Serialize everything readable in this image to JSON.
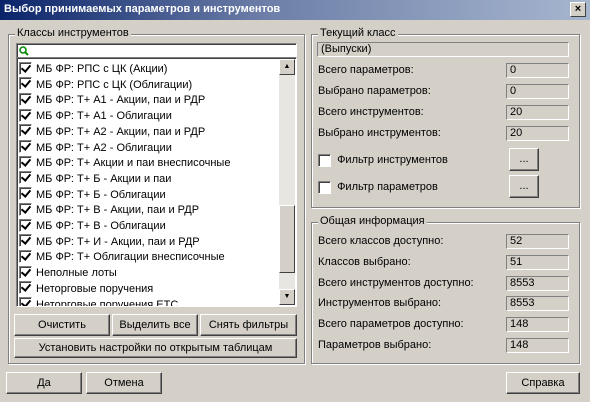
{
  "window": {
    "title": "Выбор принимаемых параметров и инструментов",
    "close_glyph": "×"
  },
  "instruments_group": {
    "legend": "Классы инструментов",
    "filter_icon": "search-icon",
    "items": [
      {
        "label": "МБ ФР: РПС с ЦК (Акции)",
        "checked": true
      },
      {
        "label": "МБ ФР: РПС с ЦК (Облигации)",
        "checked": true
      },
      {
        "label": "МБ ФР: Т+ А1 - Акции, паи и РДР",
        "checked": true
      },
      {
        "label": "МБ ФР: Т+ А1 - Облигации",
        "checked": true
      },
      {
        "label": "МБ ФР: Т+ А2 - Акции, паи и РДР",
        "checked": true
      },
      {
        "label": "МБ ФР: Т+ А2 - Облигации",
        "checked": true
      },
      {
        "label": "МБ ФР: Т+ Акции и паи внесписочные",
        "checked": true
      },
      {
        "label": "МБ ФР: Т+ Б - Акции и паи",
        "checked": true
      },
      {
        "label": "МБ ФР: Т+ Б - Облигации",
        "checked": true
      },
      {
        "label": "МБ ФР: Т+ В - Акции, паи и РДР",
        "checked": true
      },
      {
        "label": "МБ ФР: Т+ В - Облигации",
        "checked": true
      },
      {
        "label": "МБ ФР: Т+ И - Акции, паи и РДР",
        "checked": true
      },
      {
        "label": "МБ ФР: Т+ Облигации внесписочные",
        "checked": true
      },
      {
        "label": "Неполные лоты",
        "checked": true
      },
      {
        "label": "Неторговые поручения",
        "checked": true
      },
      {
        "label": "Неторговые поручения ЕТС",
        "checked": true
      }
    ],
    "buttons": {
      "clear": "Очистить",
      "select_all": "Выделить все",
      "remove_filters": "Снять фильтры",
      "apply_from_tables": "Установить настройки по открытым  таблицам"
    }
  },
  "current_class": {
    "legend": "Текущий класс",
    "class_name": "(Выпуски)",
    "rows": [
      {
        "label": "Всего параметров:",
        "value": "0"
      },
      {
        "label": "Выбрано параметров:",
        "value": "0"
      },
      {
        "label": "Всего инструментов:",
        "value": "20"
      },
      {
        "label": "Выбрано инструментов:",
        "value": "20"
      }
    ],
    "filter_instruments": {
      "label": "Фильтр инструментов",
      "checked": false,
      "button": "..."
    },
    "filter_params": {
      "label": "Фильтр параметров",
      "checked": false,
      "button": "..."
    }
  },
  "general_info": {
    "legend": "Общая информация",
    "rows": [
      {
        "label": "Всего классов доступно:",
        "value": "52"
      },
      {
        "label": "Классов выбрано:",
        "value": "51"
      },
      {
        "label": "Всего инструментов доступно:",
        "value": "8553"
      },
      {
        "label": "Инструментов выбрано:",
        "value": "8553"
      },
      {
        "label": "Всего параметров доступно:",
        "value": "148"
      },
      {
        "label": "Параметров выбрано:",
        "value": "148"
      }
    ]
  },
  "footer": {
    "ok": "Да",
    "cancel": "Отмена",
    "help": "Справка"
  }
}
